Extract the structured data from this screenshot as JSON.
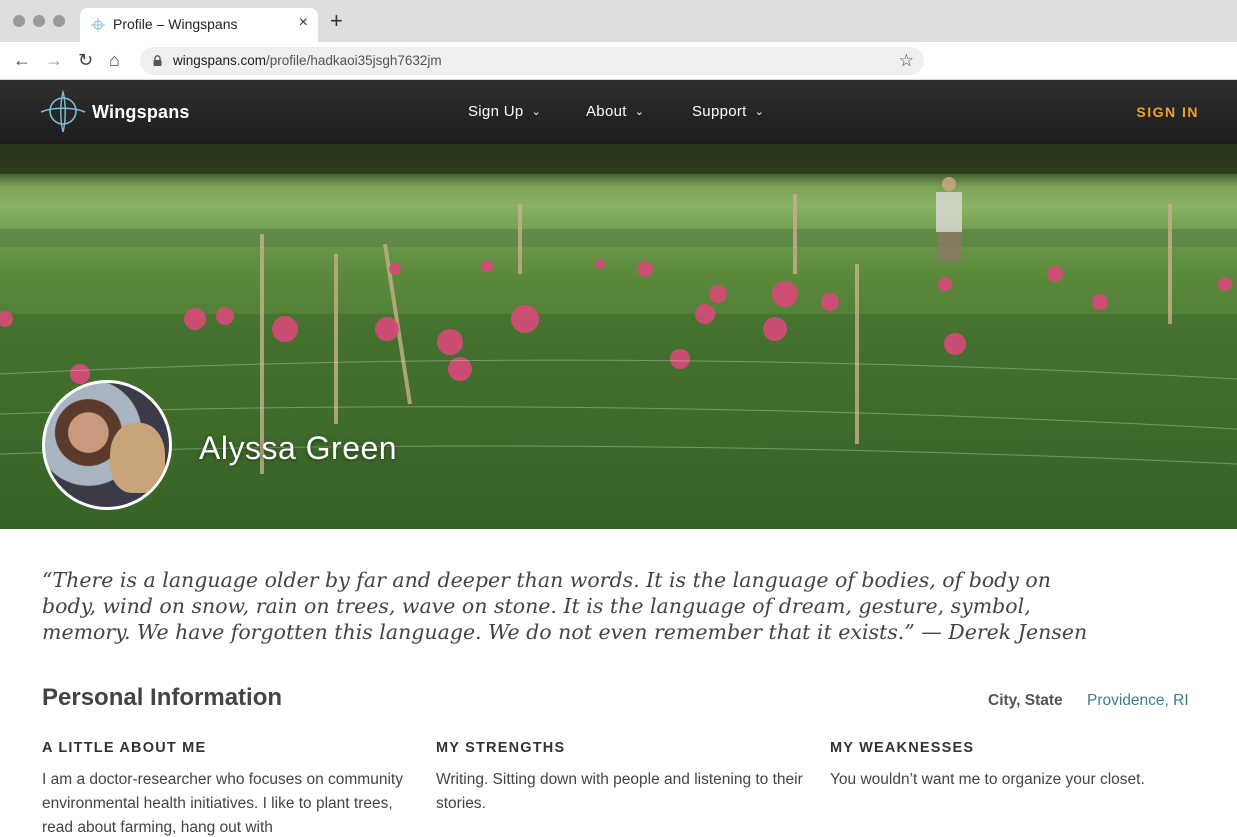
{
  "browser": {
    "tab_title": "Profile – Wingspans",
    "tab_close": "×",
    "new_tab": "+",
    "url_domain": "wingspans.com",
    "url_path": "/profile/hadkaoi35jsgh7632jm",
    "back": "←",
    "forward": "→",
    "reload": "↻",
    "home": "⌂",
    "bookmark": "☆",
    "icons": [
      "lock-icon",
      "star-icon",
      "home-icon",
      "reload-icon"
    ]
  },
  "header": {
    "brand": "Wingspans",
    "menu": [
      {
        "label": "Sign Up"
      },
      {
        "label": "About"
      },
      {
        "label": "Support"
      }
    ],
    "signin": "SIGN IN",
    "chevron": "⌄",
    "accent_color": "#f0a12b"
  },
  "profile": {
    "name": "Alyssa Green"
  },
  "quote": "“There is a language older by far and deeper than words. It is the language of bodies, of body on body, wind on snow, rain on trees, wave on stone. It is the language of dream, gesture, symbol, memory. We have forgotten this language. We do not even remember that it exists.” — Derek Jensen",
  "personal": {
    "title": "Personal Information",
    "city_label": "City, State",
    "city_value": "Providence, RI",
    "link_color": "#3e7d91",
    "columns": [
      {
        "heading": "A LITTLE ABOUT ME",
        "body": "I am a doctor-researcher who focuses on community environmental health initiatives. I like to plant trees, read about farming, hang out with"
      },
      {
        "heading": "MY STRENGTHS",
        "body": "Writing. Sitting down with people and listening to their stories."
      },
      {
        "heading": "MY WEAKNESSES",
        "body": "You wouldn’t want me to organize your closet."
      }
    ]
  }
}
